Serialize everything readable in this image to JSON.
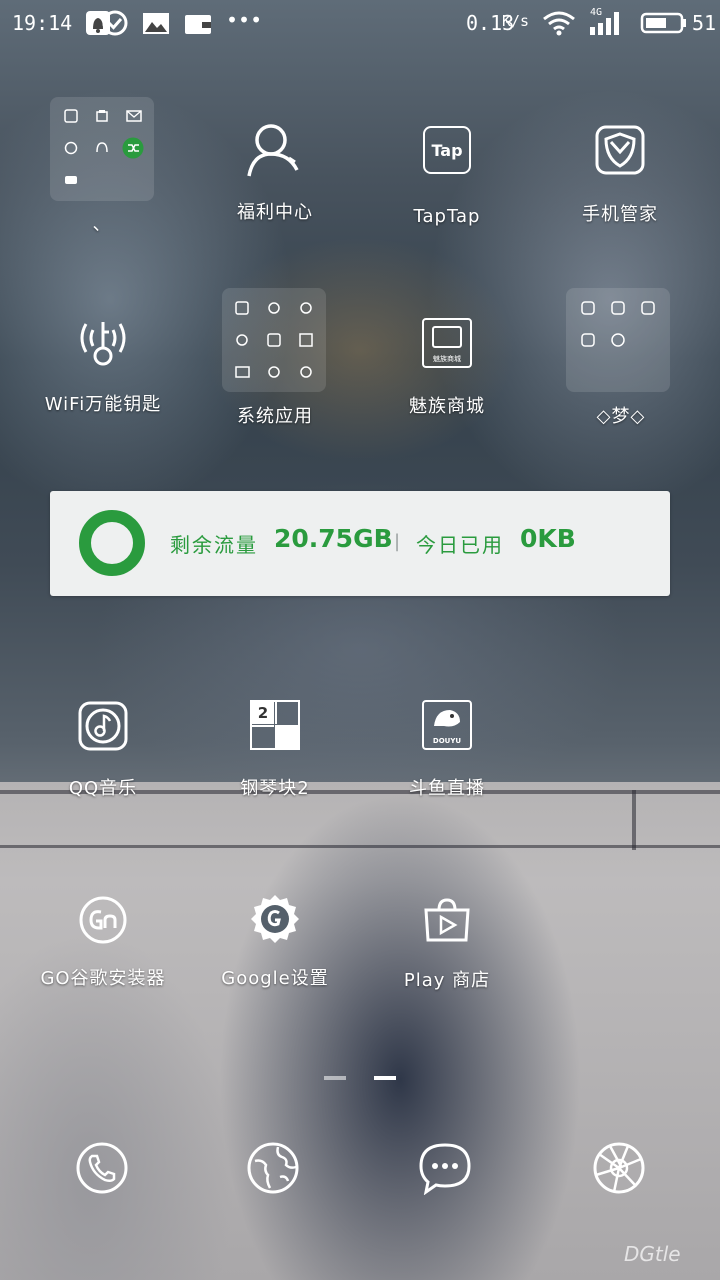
{
  "status_bar": {
    "time": "19:14",
    "net_speed": "0.13",
    "net_unit": "K/s",
    "signal_type": "4G",
    "battery": "51",
    "more": "•••",
    "icons": [
      "notification-bell-icon",
      "check-circle-icon",
      "image-icon",
      "wallet-icon",
      "wifi-icon",
      "cell-signal-icon",
      "battery-icon"
    ]
  },
  "rows": {
    "row1": {
      "folder_label": "、",
      "app2": "福利中心",
      "app3": "TapTap",
      "app4": "手机管家"
    },
    "row2": {
      "app1": "WiFi万能钥匙",
      "folder_label": "系统应用",
      "app3": "魅族商城",
      "folder4_label": "◇梦◇"
    },
    "row3": {
      "app1": "QQ音乐",
      "app2": "钢琴块2",
      "app3": "斗鱼直播"
    },
    "row4": {
      "app1": "GO谷歌安装器",
      "app2": "Google设置",
      "app3": "Play 商店"
    }
  },
  "icon_text": {
    "taptap": "Tap",
    "meizu": "魅族商城",
    "piano": "2",
    "douyu": "DOUYU"
  },
  "widget": {
    "remaining_label": "剩余流量",
    "remaining_value": "20.75GB",
    "separator": "|",
    "today_label": "今日已用",
    "today_value": "0KB",
    "ring_percent": 100,
    "accent_color": "#2a9b3e"
  },
  "dock": {
    "icons": [
      "phone-icon",
      "browser-globe-icon",
      "messages-icon",
      "camera-aperture-icon"
    ]
  },
  "watermark": "DGtle"
}
